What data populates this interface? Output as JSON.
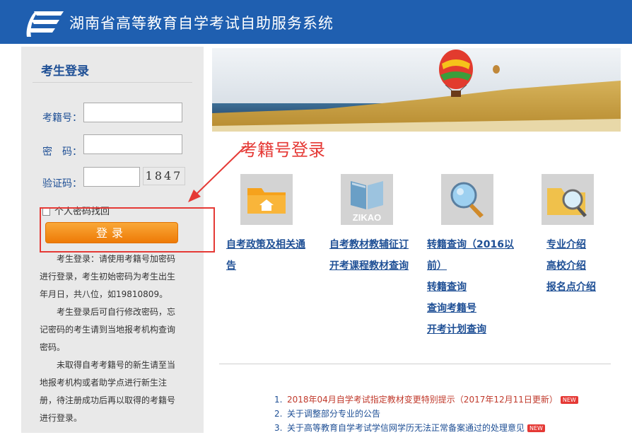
{
  "header": {
    "title": "湖南省高等教育自学考试自助服务系统"
  },
  "login": {
    "title": "考生登录",
    "exam_no_label": "考籍号",
    "password_label": "密　码",
    "captcha_label": "验证码",
    "colon": "：",
    "exam_no_value": "",
    "password_value": "",
    "captcha_value": "",
    "captcha_text": "1847",
    "remember_label": "个人密码找回",
    "button_label": "登录",
    "info_paragraphs": [
      "　　考生登录：请使用考籍号加密码进行登录，考生初始密码为考生出生年月日，共八位，如19810809。",
      "　　考生登录后可自行修改密码，忘记密码的考生请到当地报考机构查询密码。",
      "　　未取得自考考籍号的新生请至当地报考机构或者助学点进行新生注册，待注册成功后再以取得的考籍号进行登录。"
    ]
  },
  "annotation": {
    "text": "考籍号登录",
    "color": "#e53935"
  },
  "tiles": [
    {
      "icon": "folder-home-icon"
    },
    {
      "icon": "zikao-book-icon",
      "caption": "ZIKAO"
    },
    {
      "icon": "magnifier-icon"
    },
    {
      "icon": "folder-search-icon"
    }
  ],
  "links": {
    "col1": [
      "自考政策及相关通",
      "告"
    ],
    "col2": [
      "自考教材教辅征订",
      "开考课程教材查询"
    ],
    "col3": [
      "转籍查询（2016以",
      "前）",
      "转籍查询",
      "查询考籍号",
      "开考计划查询"
    ],
    "col4": [
      "专业介绍",
      "高校介绍",
      "报名点介绍"
    ]
  },
  "news": [
    {
      "num": "1.",
      "text": "2018年04月自学考试指定教材变更特别提示（2017年12月11日更新）",
      "badge": "NEW",
      "color": "#c0392b"
    },
    {
      "num": "2.",
      "text": "关于调整部分专业的公告",
      "badge": "",
      "color": "#1e4f95"
    },
    {
      "num": "3.",
      "text": "关于高等教育自学考试学信网学历无法正常备案通过的处理意见",
      "badge": "NEW",
      "color": "#1e4f95"
    }
  ],
  "colors": {
    "header_blue": "#1f5fb0",
    "link_blue": "#1e4f95",
    "button_orange": "#f29314"
  }
}
